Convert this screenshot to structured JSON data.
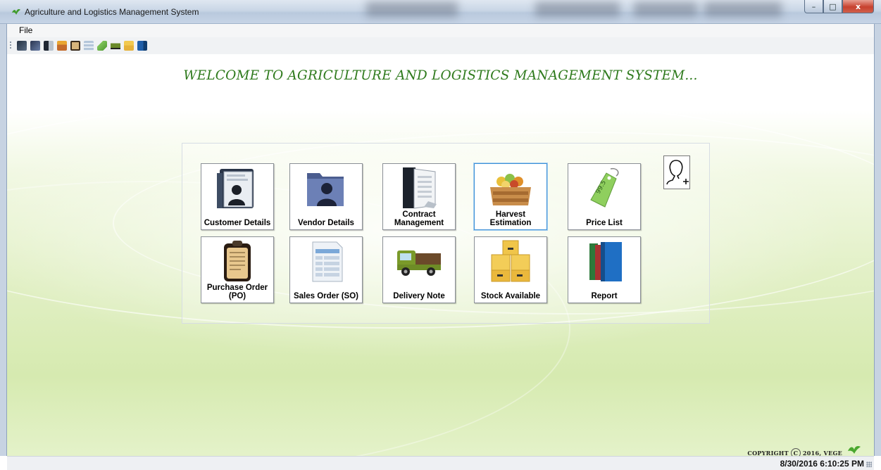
{
  "window": {
    "title": "Agriculture and Logistics Management System",
    "controls": [
      "–",
      "□",
      "x"
    ]
  },
  "menu": {
    "file": "File"
  },
  "toolbar": {
    "icons": [
      "customer-icon",
      "vendor-icon",
      "contract-icon",
      "harvest-icon",
      "purchase-order-icon",
      "sales-order-icon",
      "price-tag-icon",
      "delivery-truck-icon",
      "stock-boxes-icon",
      "report-books-icon"
    ]
  },
  "main": {
    "welcome": "WELCOME TO AGRICULTURE AND LOGISTICS MANAGEMENT SYSTEM...",
    "tiles": [
      {
        "label": "Customer Details",
        "icon": "customer-folder-icon"
      },
      {
        "label": "Vendor Details",
        "icon": "vendor-folder-icon"
      },
      {
        "label": "Contract Management",
        "icon": "contract-binder-icon"
      },
      {
        "label": "Harvest Estimation",
        "icon": "harvest-crate-icon",
        "selected": true
      },
      {
        "label": "Price List",
        "icon": "price-tag-icon"
      },
      {
        "label": "Purchase Order (PO)",
        "icon": "clipboard-icon"
      },
      {
        "label": "Sales Order (SO)",
        "icon": "spreadsheet-icon"
      },
      {
        "label": "Delivery Note",
        "icon": "delivery-truck-icon"
      },
      {
        "label": "Stock Available",
        "icon": "stock-boxes-icon"
      },
      {
        "label": "Report",
        "icon": "report-books-icon"
      }
    ],
    "add_user": {
      "icon": "add-user-icon"
    }
  },
  "footer": {
    "copyright_prefix": "COPYRIGHT",
    "copyright_symbol": "C",
    "copyright_suffix": "2016, VEGE",
    "datetime": "8/30/2016 6:10:25 PM"
  },
  "colors": {
    "welcome": "#2e7a1c",
    "accent": "#3c8fd6"
  }
}
